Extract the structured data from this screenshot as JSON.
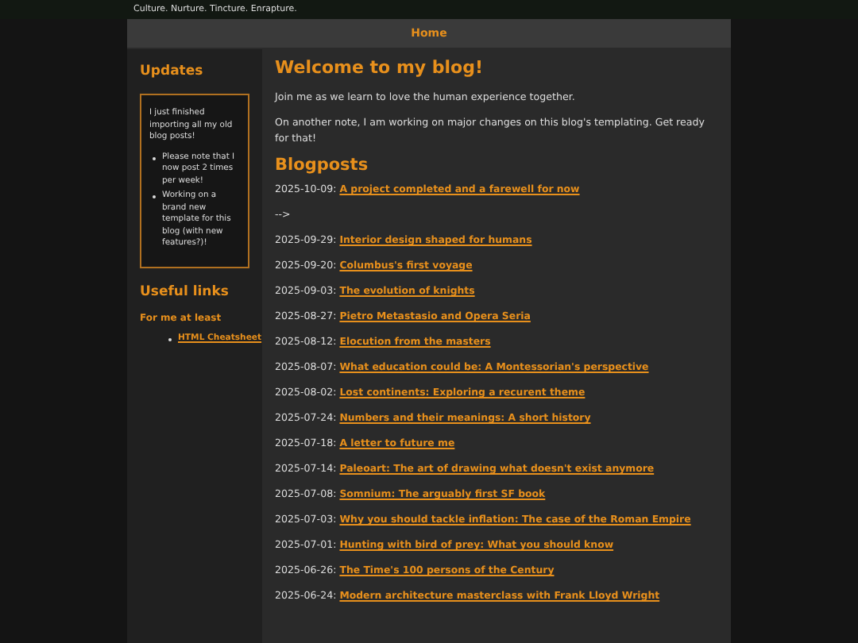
{
  "tagline": "Culture. Nurture. Tincture. Enrapture.",
  "nav": [
    {
      "label": "Home",
      "selected": true
    }
  ],
  "sidebar": {
    "updates_title": "Updates",
    "updates_intro": "I just finished importing all my old blog posts!",
    "updates_items": [
      "Please note that I now post 2 times per week!",
      "Working on a brand new template for this blog (with new features?)!"
    ],
    "links_title": "Useful links",
    "links_subtitle": "For me at least",
    "links": [
      "HTML Cheatsheet"
    ]
  },
  "main": {
    "title": "Welcome to my blog!",
    "paragraphs": [
      "Join me as we learn to love the human experience together.",
      "On another note, I am working on major changes on this blog's templating. Get ready for that!"
    ],
    "posts_title": "Blogposts",
    "posts": [
      {
        "kind": "post",
        "date": "2025-10-09:",
        "title": "A project completed and a farewell for now"
      },
      {
        "kind": "stray",
        "text": "-->"
      },
      {
        "kind": "post",
        "date": "2025-09-29:",
        "title": "Interior design shaped for humans"
      },
      {
        "kind": "post",
        "date": "2025-09-20:",
        "title": "Columbus's first voyage"
      },
      {
        "kind": "post",
        "date": "2025-09-03:",
        "title": "The evolution of knights"
      },
      {
        "kind": "post",
        "date": "2025-08-27:",
        "title": "Pietro Metastasio and Opera Seria"
      },
      {
        "kind": "post",
        "date": "2025-08-12:",
        "title": "Elocution from the masters"
      },
      {
        "kind": "post",
        "date": "2025-08-07:",
        "title": "What education could be: A Montessorian's perspective"
      },
      {
        "kind": "post",
        "date": "2025-08-02:",
        "title": "Lost continents: Exploring a recurent theme"
      },
      {
        "kind": "post",
        "date": "2025-07-24:",
        "title": "Numbers and their meanings: A short history"
      },
      {
        "kind": "post",
        "date": "2025-07-18:",
        "title": "A letter to future me"
      },
      {
        "kind": "post",
        "date": "2025-07-14:",
        "title": "Paleoart: The art of drawing what doesn't exist anymore"
      },
      {
        "kind": "post",
        "date": "2025-07-08:",
        "title": "Somnium: The arguably first SF book"
      },
      {
        "kind": "post",
        "date": "2025-07-03:",
        "title": "Why you should tackle inflation: The case of the Roman Empire"
      },
      {
        "kind": "post",
        "date": "2025-07-01:",
        "title": "Hunting with bird of prey: What you should know"
      },
      {
        "kind": "post",
        "date": "2025-06-26:",
        "title": "The Time's 100 persons of the Century"
      },
      {
        "kind": "post",
        "date": "2025-06-24:",
        "title": "Modern architecture masterclass with Frank Lloyd Wright"
      }
    ]
  }
}
